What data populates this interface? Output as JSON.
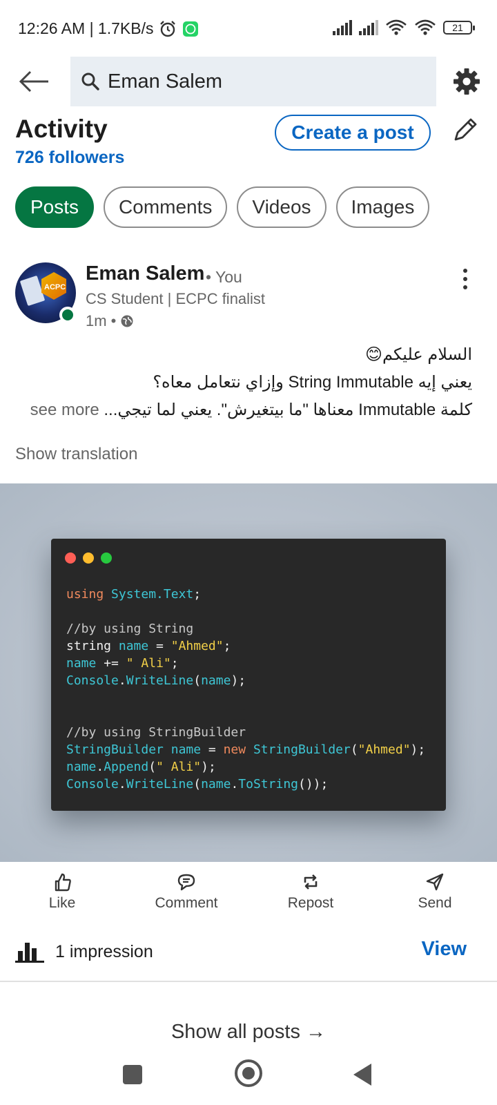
{
  "status_bar": {
    "time": "12:26 AM | 1.7KB/s",
    "battery": "21"
  },
  "search": {
    "value": "Eman Salem"
  },
  "activity": {
    "title": "Activity",
    "followers": "726 followers",
    "create_post": "Create a post"
  },
  "filters": [
    "Posts",
    "Comments",
    "Videos",
    "Images"
  ],
  "post": {
    "author": "Eman Salem",
    "you_label": "• You",
    "headline": "CS Student | ECPC finalist",
    "time": "1m •",
    "text_line1": "السلام عليكم😊",
    "text_line2": "يعني إيه String Immutable وإزاي نتعامل معاه؟",
    "text_line3": "كلمة Immutable معناها \"ما بيتغيرش\". يعني لما تيجي...",
    "see_more": "see more",
    "show_translation": "Show translation",
    "avatar_text": "ACPC"
  },
  "code": {
    "l1_kw": "using",
    "l1_ns": "System.Text",
    "l1_end": ";",
    "l2": "//by using String",
    "l3_a": "string ",
    "l3_b": "name",
    "l3_c": " = ",
    "l3_d": "\"Ahmed\"",
    "l3_e": ";",
    "l4_a": "name",
    "l4_b": " += ",
    "l4_c": "\" Ali\"",
    "l4_d": ";",
    "l5_a": "Console",
    "l5_b": ".",
    "l5_c": "WriteLine",
    "l5_d": "(",
    "l5_e": "name",
    "l5_f": ");",
    "l6": "//by using StringBuilder",
    "l7_a": "StringBuilder",
    "l7_b": " name",
    "l7_c": " = ",
    "l7_d": "new",
    "l7_e": " StringBuilder",
    "l7_f": "(",
    "l7_g": "\"Ahmed\"",
    "l7_h": ");",
    "l8_a": "name",
    "l8_b": ".",
    "l8_c": "Append",
    "l8_d": "(",
    "l8_e": "\" Ali\"",
    "l8_f": ");",
    "l9_a": "Console",
    "l9_b": ".",
    "l9_c": "WriteLine",
    "l9_d": "(",
    "l9_e": "name",
    "l9_f": ".",
    "l9_g": "ToString",
    "l9_h": "());"
  },
  "actions": {
    "like": "Like",
    "comment": "Comment",
    "repost": "Repost",
    "send": "Send"
  },
  "impressions": {
    "text": "1 impression",
    "view": "View"
  },
  "show_all": "Show all posts →",
  "colors": {
    "brand_blue": "#0a66c2",
    "active_green": "#057642"
  }
}
